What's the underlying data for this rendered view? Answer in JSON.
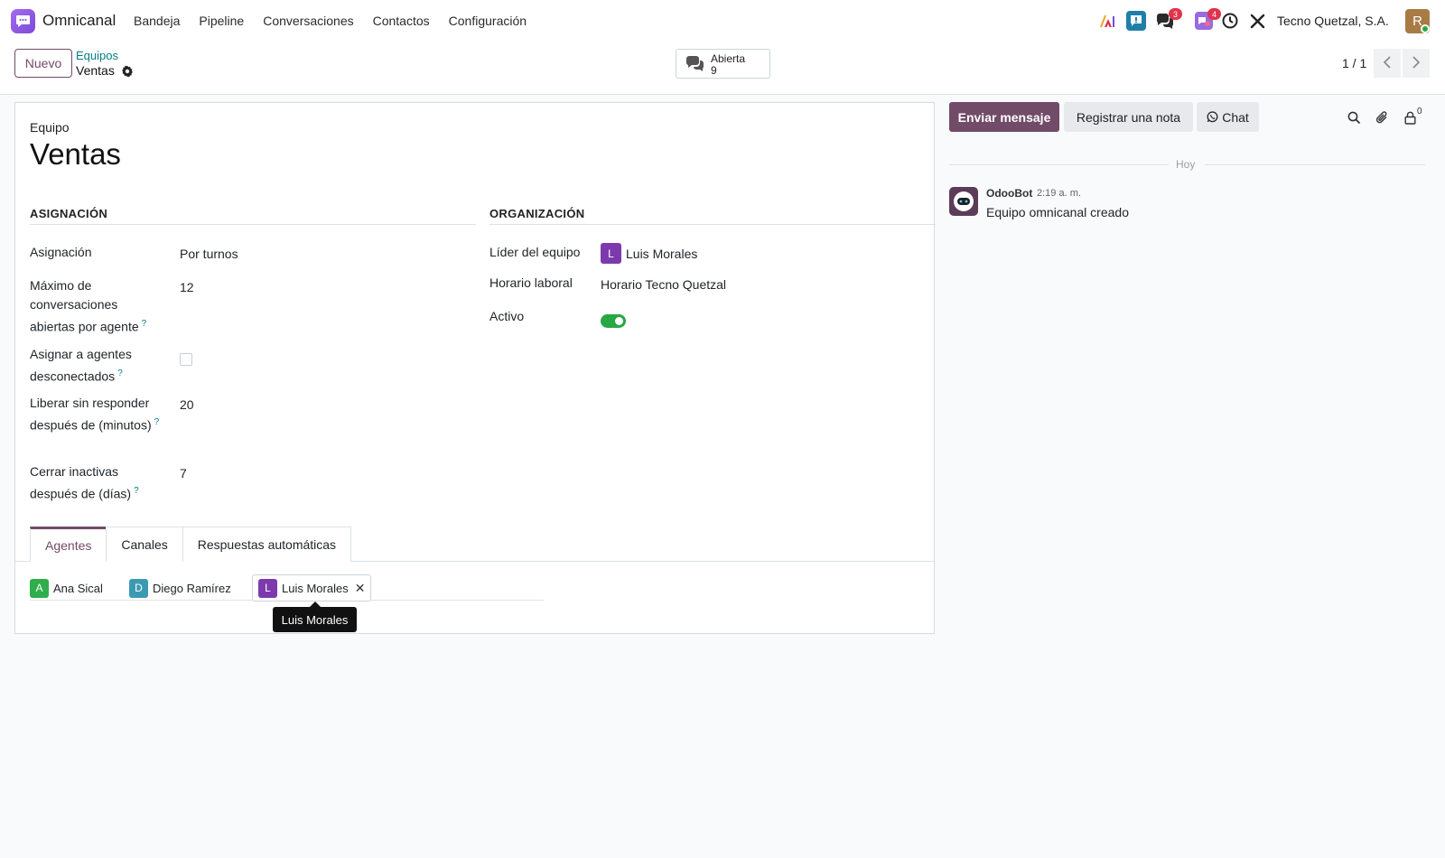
{
  "app": {
    "name": "Omnicanal"
  },
  "menu": [
    "Bandeja",
    "Pipeline",
    "Conversaciones",
    "Contactos",
    "Configuración"
  ],
  "systray": {
    "messages_count": "3",
    "activities_count": "4",
    "company": "Tecno Quetzal, S.A.",
    "user_initial": "R"
  },
  "control": {
    "new_label": "Nuevo",
    "breadcrumb_parent": "Equipos",
    "breadcrumb_current": "Ventas",
    "stat_label": "Abierta",
    "stat_value": "9",
    "pager": "1 / 1"
  },
  "form": {
    "record_type_label": "Equipo",
    "name": "Ventas",
    "section_assignment": "ASIGNACIÓN",
    "section_org": "ORGANIZACIÓN",
    "fields": {
      "assignment_label": "Asignación",
      "assignment_value": "Por turnos",
      "max_label": "Máximo de conversaciones abiertas por agente",
      "max_value": "12",
      "offline_label": "Asignar a agentes desconectados",
      "offline_checked": false,
      "release_label": "Liberar sin responder después de (minutos)",
      "release_value": "20",
      "close_label": "Cerrar inactivas después de (días)",
      "close_value": "7",
      "leader_label": "Líder del equipo",
      "leader_value": "Luis Morales",
      "leader_initial": "L",
      "schedule_label": "Horario laboral",
      "schedule_value": "Horario Tecno Quetzal",
      "active_label": "Activo",
      "active_value": true
    },
    "tabs": [
      "Agentes",
      "Canales",
      "Respuestas automáticas"
    ],
    "agents": [
      {
        "initial": "A",
        "name": "Ana Sical",
        "color": "#2fae4c"
      },
      {
        "initial": "D",
        "name": "Diego Ramírez",
        "color": "#3b9ab2"
      },
      {
        "initial": "L",
        "name": "Luis Morales",
        "color": "#7c3aad"
      }
    ],
    "tooltip": "Luis Morales"
  },
  "chatter": {
    "send_label": "Enviar mensaje",
    "note_label": "Registrar una nota",
    "chat_label": "Chat",
    "followers_count": "0",
    "day": "Hoy",
    "message": {
      "author": "OdooBot",
      "time": "2:19 a. m.",
      "body": "Equipo omnicanal creado"
    }
  },
  "colors": {
    "brand": "#714b67",
    "link": "#017e84",
    "success": "#28a745",
    "badge": "#e0334a"
  }
}
